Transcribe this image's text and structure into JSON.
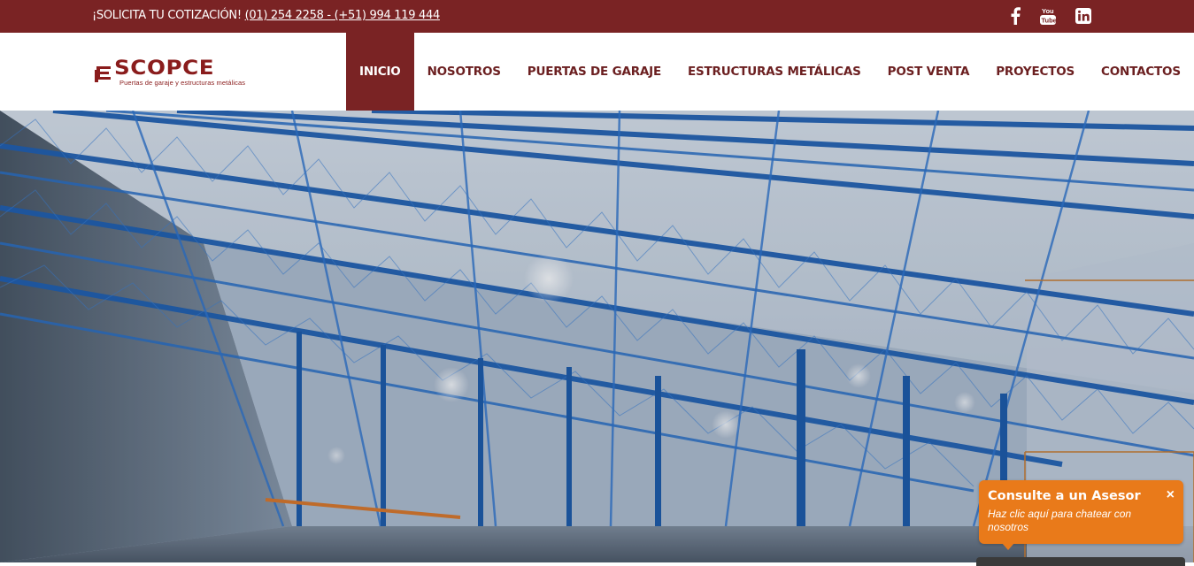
{
  "topbar": {
    "quote_label": "¡SOLICITA TU COTIZACIÓN!",
    "phones": "(01) 254 2258 - (+51) 994 119 444",
    "social": [
      "facebook-icon",
      "youtube-icon",
      "linkedin-icon"
    ]
  },
  "logo": {
    "name": "SCOPCE",
    "tagline": "Puertas de garaje y estructuras metálicas"
  },
  "nav": {
    "items": [
      "INICIO",
      "NOSOTROS",
      "PUERTAS DE GARAJE",
      "ESTRUCTURAS METÁLICAS",
      "POST VENTA",
      "PROYECTOS",
      "CONTACTOS"
    ],
    "active": "INICIO"
  },
  "chat": {
    "title": "Consulte a un Asesor",
    "subtitle": "Haz clic aquí para chatear con nosotros",
    "close": "×"
  },
  "colors": {
    "brand": "#7a2324",
    "chat": "#e97a1a",
    "steel": "#1f5fb0"
  }
}
